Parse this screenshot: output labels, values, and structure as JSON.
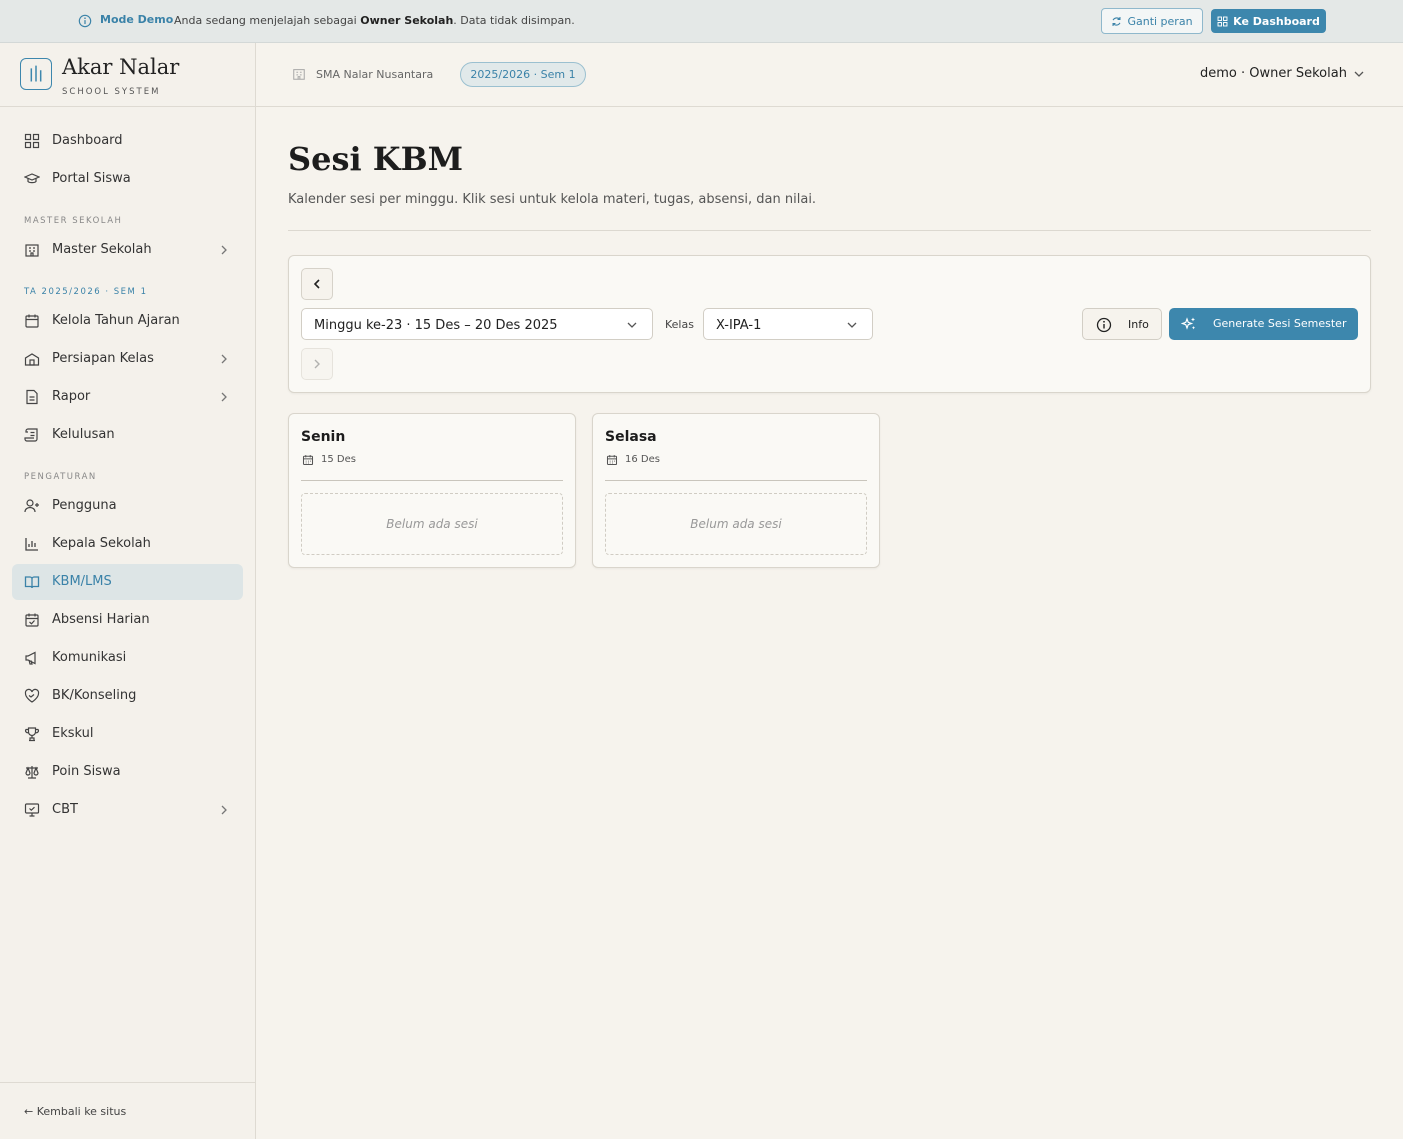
{
  "banner": {
    "mode_label": "Mode Demo",
    "message_prefix": "Anda sedang menjelajah sebagai ",
    "message_role": "Owner Sekolah",
    "message_suffix": ". Data tidak disimpan.",
    "switch_role_label": "Ganti peran",
    "dashboard_label": "Ke Dashboard"
  },
  "brand": {
    "name": "Akar Nalar",
    "subtitle": "SCHOOL SYSTEM"
  },
  "sidebar": {
    "items": [
      {
        "label": "Dashboard",
        "icon": "layout-grid-icon"
      },
      {
        "label": "Portal Siswa",
        "icon": "graduation-cap-icon"
      }
    ],
    "section_master": "MASTER SEKOLAH",
    "master_items": [
      {
        "label": "Master Sekolah",
        "icon": "building-icon"
      }
    ],
    "section_ta": "TA 2025/2026 · SEM 1",
    "ta_items": [
      {
        "label": "Kelola Tahun Ajaran",
        "icon": "calendar-icon"
      },
      {
        "label": "Persiapan Kelas",
        "icon": "school-icon"
      },
      {
        "label": "Rapor",
        "icon": "file-text-icon"
      },
      {
        "label": "Kelulusan",
        "icon": "scroll-icon"
      }
    ],
    "section_settings": "PENGATURAN",
    "settings_items": [
      {
        "label": "Pengguna",
        "icon": "user-plus-icon"
      },
      {
        "label": "Kepala Sekolah",
        "icon": "bar-chart-icon"
      },
      {
        "label": "KBM/LMS",
        "icon": "book-open-icon",
        "active": true
      },
      {
        "label": "Absensi Harian",
        "icon": "calendar-check-icon"
      },
      {
        "label": "Komunikasi",
        "icon": "megaphone-icon"
      },
      {
        "label": "BK/Konseling",
        "icon": "heart-handshake-icon"
      },
      {
        "label": "Ekskul",
        "icon": "trophy-icon"
      },
      {
        "label": "Poin Siswa",
        "icon": "scale-icon"
      },
      {
        "label": "CBT",
        "icon": "monitor-check-icon"
      }
    ],
    "back_label": "← Kembali ke situs"
  },
  "topbar": {
    "school_name": "SMA Nalar Nusantara",
    "term_tag": "2025/2026 · Sem 1",
    "user_label": "demo · Owner Sekolah"
  },
  "page": {
    "title": "Sesi KBM",
    "subtitle": "Kalender sesi per minggu. Klik sesi untuk kelola materi, tugas, absensi, dan nilai."
  },
  "toolbar": {
    "week_select": "Minggu ke-23 · 15 Des – 20 Des 2025",
    "class_label": "Kelas",
    "class_select": "X-IPA-1",
    "info_label": "Info",
    "generate_label": "Generate Sesi Semester"
  },
  "days": [
    {
      "day": "Senin",
      "date": "15 Des",
      "empty": "Belum ada sesi"
    },
    {
      "day": "Selasa",
      "date": "16 Des",
      "empty": "Belum ada sesi"
    }
  ],
  "colors": {
    "accent": "#3d87ad",
    "background": "#f6f3ed",
    "active_nav": "#dde5e6"
  }
}
